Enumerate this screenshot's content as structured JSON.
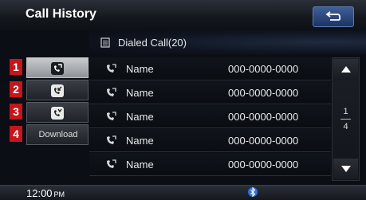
{
  "header": {
    "title": "Call History"
  },
  "list": {
    "heading": "Dialed Call(20)",
    "rows": [
      {
        "name": "Name",
        "number": "000-0000-0000"
      },
      {
        "name": "Name",
        "number": "000-0000-0000"
      },
      {
        "name": "Name",
        "number": "000-0000-0000"
      },
      {
        "name": "Name",
        "number": "000-0000-0000"
      },
      {
        "name": "Name",
        "number": "000-0000-0000"
      }
    ]
  },
  "tabs": {
    "items": [
      {
        "icon": "dialed-call-icon",
        "badge": "1"
      },
      {
        "icon": "received-call-icon",
        "badge": "2"
      },
      {
        "icon": "missed-call-icon",
        "badge": "3"
      },
      {
        "label": "Download",
        "badge": "4"
      }
    ]
  },
  "pager": {
    "current": "1",
    "total": "4"
  },
  "status": {
    "time": "12:00",
    "ampm": "PM"
  },
  "colors": {
    "badge": "#c4161c",
    "accent": "#3f5f95"
  }
}
